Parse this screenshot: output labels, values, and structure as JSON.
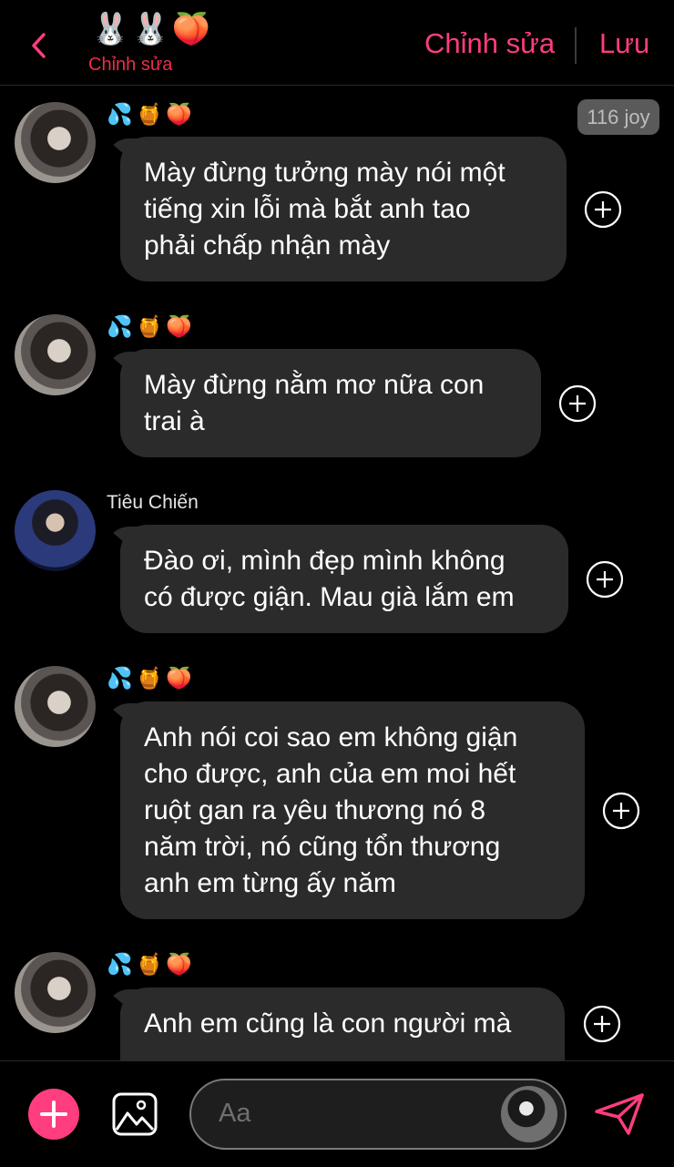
{
  "header": {
    "back_icon": "chevron-left-icon",
    "emojis": "🐰🐰🍑",
    "subtitle": "Chỉnh sửa",
    "edit_label": "Chỉnh sửa",
    "save_label": "Lưu",
    "accent_color": "#ff3d7f"
  },
  "badge": "116 joy",
  "messages": [
    {
      "emojis": "💦🍯🍑",
      "sender": "",
      "text": [
        "Mày đừng tưởng mày nói một",
        "tiếng xin lỗi mà bắt anh tao",
        "phải chấp nhận mày"
      ]
    },
    {
      "emojis": "💦🍯🍑",
      "sender": "",
      "text": [
        "Mày đừng nằm mơ nữa con",
        "trai à"
      ]
    },
    {
      "emojis": "",
      "sender": "Tiêu Chiến",
      "text": [
        "Đào ơi, mình đẹp mình không",
        "có được giận. Mau già lắm em"
      ]
    },
    {
      "emojis": "💦🍯🍑",
      "sender": "",
      "text": [
        "Anh nói coi sao em không giận",
        "cho được, anh của em moi hết",
        "ruột gan ra yêu thương nó 8",
        "năm trời, nó cũng tổn thương",
        "anh em từng ấy năm"
      ]
    },
    {
      "emojis": "💦🍯🍑",
      "sender": "",
      "text": [
        "Anh em cũng là con người mà"
      ]
    }
  ],
  "composer": {
    "placeholder": "Aa",
    "add_icon": "plus-icon",
    "image_icon": "image-icon",
    "send_icon": "send-icon"
  }
}
